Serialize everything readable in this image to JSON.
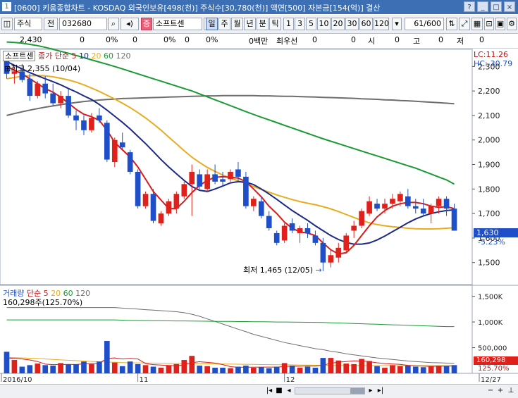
{
  "window": {
    "title": "[0600] 키움종합차트 - KOSDAQ 외국인보유[498(천)] 주식수[30,780(천)] 액면[500] 자본금[154(억)] 결산",
    "controls": [
      "?",
      "_",
      "□",
      "×"
    ]
  },
  "toolbar": {
    "type_select": "주식",
    "mode": "전",
    "code": "032680",
    "badge": "증",
    "name": "소프트센",
    "periods": [
      "일",
      "주",
      "월",
      "년",
      "분",
      "틱"
    ],
    "active_period": "일",
    "intervals": [
      "1",
      "3",
      "5",
      "10",
      "20",
      "30",
      "60",
      "120"
    ],
    "count": "61",
    "count_total": "/600"
  },
  "inforow": {
    "values": [
      "2,430",
      "0",
      "0%",
      "0",
      "0%",
      "0",
      "0%",
      "0백만",
      "최우선",
      "0",
      "0",
      "시",
      "0",
      "고",
      "0",
      "저",
      "0"
    ]
  },
  "price_panel": {
    "legend_name": "소프트센",
    "legend_ma": "종가 단순",
    "ma_periods": [
      "5",
      "10",
      "20",
      "60",
      "120"
    ],
    "high_label": "최고 2,355 (10/04)",
    "low_label": "최저 1,465 (12/05)",
    "lc": "LC:11.26",
    "hc": "HC:-30.79",
    "current_price": "1,630",
    "change_pct": "-5.23%"
  },
  "volume_panel": {
    "legend_name": "거래량",
    "legend_ma": "단순",
    "ma_periods": [
      "5",
      "20",
      "60",
      "120"
    ],
    "legend_value": "160,298주(125.70%)",
    "current_volume": "160,298",
    "current_pct": "125.70%"
  },
  "colors": {
    "up": "#e0211b",
    "down": "#1f4fc8",
    "ma5": "#d61c1c",
    "ma10": "#1c2a86",
    "ma20": "#e8ad1f",
    "ma60": "#199a32",
    "ma120": "#6e6e6e"
  },
  "chart_data": [
    {
      "type": "candlestick",
      "price_axis": {
        "ticks": [
          1500,
          1600,
          1700,
          1800,
          1900,
          2000,
          2100,
          2200,
          2300
        ],
        "ylim": [
          1410,
          2370
        ]
      },
      "x_labels": [
        {
          "label": "2016/10",
          "index": 0
        },
        {
          "label": "11",
          "index": 17
        },
        {
          "label": "12",
          "index": 36
        },
        {
          "label": "12/27",
          "index": 52
        }
      ],
      "candles": [
        {
          "o": 2330,
          "h": 2355,
          "l": 2250,
          "c": 2270
        },
        {
          "o": 2270,
          "h": 2300,
          "l": 2230,
          "c": 2280
        },
        {
          "o": 2280,
          "h": 2310,
          "l": 2235,
          "c": 2245
        },
        {
          "o": 2250,
          "h": 2270,
          "l": 2160,
          "c": 2180
        },
        {
          "o": 2180,
          "h": 2240,
          "l": 2170,
          "c": 2230
        },
        {
          "o": 2230,
          "h": 2260,
          "l": 2170,
          "c": 2190
        },
        {
          "o": 2190,
          "h": 2230,
          "l": 2140,
          "c": 2150
        },
        {
          "o": 2150,
          "h": 2200,
          "l": 2130,
          "c": 2180
        },
        {
          "o": 2180,
          "h": 2210,
          "l": 2090,
          "c": 2100
        },
        {
          "o": 2100,
          "h": 2120,
          "l": 2040,
          "c": 2080
        },
        {
          "o": 2080,
          "h": 2100,
          "l": 2020,
          "c": 2040
        },
        {
          "o": 2040,
          "h": 2110,
          "l": 2030,
          "c": 2090
        },
        {
          "o": 2100,
          "h": 2130,
          "l": 2070,
          "c": 2080
        },
        {
          "o": 2070,
          "h": 2080,
          "l": 1910,
          "c": 1920
        },
        {
          "o": 1910,
          "h": 2010,
          "l": 1890,
          "c": 2000
        },
        {
          "o": 1990,
          "h": 2030,
          "l": 1960,
          "c": 1970
        },
        {
          "o": 1950,
          "h": 1960,
          "l": 1860,
          "c": 1870
        },
        {
          "o": 1870,
          "h": 1880,
          "l": 1720,
          "c": 1730
        },
        {
          "o": 1730,
          "h": 1790,
          "l": 1720,
          "c": 1780
        },
        {
          "o": 1780,
          "h": 1800,
          "l": 1660,
          "c": 1670
        },
        {
          "o": 1660,
          "h": 1710,
          "l": 1650,
          "c": 1700
        },
        {
          "o": 1700,
          "h": 1760,
          "l": 1690,
          "c": 1750
        },
        {
          "o": 1720,
          "h": 1790,
          "l": 1700,
          "c": 1780
        },
        {
          "o": 1770,
          "h": 1830,
          "l": 1760,
          "c": 1820
        },
        {
          "o": 1820,
          "h": 1900,
          "l": 1690,
          "c": 1870
        },
        {
          "o": 1860,
          "h": 1880,
          "l": 1800,
          "c": 1810
        },
        {
          "o": 1800,
          "h": 1880,
          "l": 1790,
          "c": 1860
        },
        {
          "o": 1860,
          "h": 1900,
          "l": 1820,
          "c": 1830
        },
        {
          "o": 1840,
          "h": 1870,
          "l": 1810,
          "c": 1830
        },
        {
          "o": 1840,
          "h": 1880,
          "l": 1830,
          "c": 1870
        },
        {
          "o": 1880,
          "h": 1910,
          "l": 1830,
          "c": 1850
        },
        {
          "o": 1850,
          "h": 1870,
          "l": 1720,
          "c": 1730
        },
        {
          "o": 1730,
          "h": 1770,
          "l": 1710,
          "c": 1760
        },
        {
          "o": 1750,
          "h": 1770,
          "l": 1680,
          "c": 1690
        },
        {
          "o": 1690,
          "h": 1710,
          "l": 1630,
          "c": 1640
        },
        {
          "o": 1620,
          "h": 1630,
          "l": 1570,
          "c": 1580
        },
        {
          "o": 1590,
          "h": 1660,
          "l": 1580,
          "c": 1650
        },
        {
          "o": 1660,
          "h": 1680,
          "l": 1620,
          "c": 1630
        },
        {
          "o": 1620,
          "h": 1650,
          "l": 1580,
          "c": 1640
        },
        {
          "o": 1640,
          "h": 1660,
          "l": 1600,
          "c": 1620
        },
        {
          "o": 1610,
          "h": 1630,
          "l": 1570,
          "c": 1580
        },
        {
          "o": 1580,
          "h": 1600,
          "l": 1465,
          "c": 1500
        },
        {
          "o": 1500,
          "h": 1550,
          "l": 1480,
          "c": 1530
        },
        {
          "o": 1520,
          "h": 1580,
          "l": 1500,
          "c": 1560
        },
        {
          "o": 1550,
          "h": 1620,
          "l": 1540,
          "c": 1610
        },
        {
          "o": 1630,
          "h": 1670,
          "l": 1600,
          "c": 1650
        },
        {
          "o": 1650,
          "h": 1720,
          "l": 1640,
          "c": 1710
        },
        {
          "o": 1700,
          "h": 1770,
          "l": 1690,
          "c": 1750
        },
        {
          "o": 1740,
          "h": 1760,
          "l": 1710,
          "c": 1720
        },
        {
          "o": 1720,
          "h": 1760,
          "l": 1700,
          "c": 1740
        },
        {
          "o": 1740,
          "h": 1780,
          "l": 1720,
          "c": 1760
        },
        {
          "o": 1750,
          "h": 1790,
          "l": 1730,
          "c": 1780
        },
        {
          "o": 1770,
          "h": 1800,
          "l": 1720,
          "c": 1730
        },
        {
          "o": 1730,
          "h": 1760,
          "l": 1700,
          "c": 1720
        },
        {
          "o": 1720,
          "h": 1760,
          "l": 1690,
          "c": 1700
        },
        {
          "o": 1700,
          "h": 1740,
          "l": 1660,
          "c": 1730
        },
        {
          "o": 1730,
          "h": 1770,
          "l": 1700,
          "c": 1760
        },
        {
          "o": 1760,
          "h": 1770,
          "l": 1690,
          "c": 1720
        },
        {
          "o": 1720,
          "h": 1740,
          "l": 1630,
          "c": 1630
        }
      ],
      "ma120": [
        2100,
        2108,
        2115,
        2122,
        2128,
        2134,
        2139,
        2144,
        2149,
        2153,
        2157,
        2160,
        2163,
        2165,
        2167,
        2169,
        2170,
        2171,
        2172,
        2173,
        2174,
        2175,
        2176,
        2177,
        2178,
        2179,
        2180,
        2180,
        2181,
        2181,
        2181,
        2181,
        2181,
        2180,
        2180,
        2179,
        2178,
        2178,
        2177,
        2176,
        2175,
        2174,
        2173,
        2172,
        2171,
        2170,
        2168,
        2167,
        2166,
        2164,
        2163,
        2161,
        2160,
        2158,
        2156,
        2154,
        2152,
        2150,
        2148
      ],
      "ma60": [
        2400,
        2398,
        2395,
        2390,
        2385,
        2378,
        2370,
        2362,
        2354,
        2345,
        2336,
        2327,
        2318,
        2309,
        2300,
        2290,
        2280,
        2270,
        2260,
        2250,
        2240,
        2230,
        2220,
        2210,
        2200,
        2188,
        2176,
        2164,
        2152,
        2140,
        2128,
        2116,
        2104,
        2093,
        2082,
        2071,
        2060,
        2049,
        2038,
        2027,
        2016,
        2005,
        1995,
        1985,
        1975,
        1965,
        1955,
        1945,
        1935,
        1925,
        1915,
        1905,
        1895,
        1885,
        1873,
        1861,
        1849,
        1837,
        1820
      ],
      "ma20": [
        2250,
        2255,
        2260,
        2262,
        2263,
        2262,
        2258,
        2252,
        2245,
        2236,
        2225,
        2212,
        2198,
        2183,
        2167,
        2150,
        2132,
        2112,
        2090,
        2066,
        2040,
        2012,
        1984,
        1956,
        1930,
        1908,
        1888,
        1872,
        1857,
        1845,
        1833,
        1822,
        1810,
        1798,
        1787,
        1776,
        1766,
        1757,
        1749,
        1742,
        1736,
        1728,
        1719,
        1708,
        1696,
        1684,
        1672,
        1662,
        1655,
        1650,
        1646,
        1643,
        1640,
        1638,
        1637,
        1637,
        1638,
        1640,
        1642
      ],
      "ma10": [
        2320,
        2305,
        2290,
        2275,
        2262,
        2250,
        2238,
        2225,
        2210,
        2196,
        2180,
        2165,
        2145,
        2122,
        2097,
        2072,
        2045,
        2015,
        1985,
        1953,
        1920,
        1890,
        1862,
        1835,
        1810,
        1795,
        1790,
        1800,
        1812,
        1825,
        1830,
        1828,
        1818,
        1800,
        1780,
        1758,
        1735,
        1712,
        1692,
        1672,
        1650,
        1630,
        1610,
        1594,
        1582,
        1575,
        1575,
        1580,
        1592,
        1608,
        1626,
        1644,
        1662,
        1678,
        1690,
        1700,
        1707,
        1712,
        1715
      ],
      "ma5": [
        2300,
        2285,
        2270,
        2250,
        2230,
        2210,
        2195,
        2175,
        2150,
        2125,
        2105,
        2095,
        2080,
        2040,
        1990,
        1960,
        1930,
        1890,
        1840,
        1790,
        1755,
        1720,
        1720,
        1750,
        1785,
        1815,
        1835,
        1848,
        1850,
        1848,
        1845,
        1830,
        1800,
        1768,
        1730,
        1700,
        1665,
        1640,
        1625,
        1620,
        1610,
        1580,
        1552,
        1535,
        1540,
        1570,
        1610,
        1650,
        1686,
        1712,
        1730,
        1740,
        1745,
        1745,
        1740,
        1730,
        1725,
        1728,
        1720
      ]
    },
    {
      "type": "bar",
      "volume_axis": {
        "ticks": [
          500000,
          1000000,
          1500000
        ],
        "tick_labels": [
          "500,000",
          "1,000K",
          "1,500K"
        ],
        "ylim": [
          0,
          1700000
        ]
      },
      "volumes": [
        420000,
        260000,
        130000,
        160000,
        190000,
        160000,
        150000,
        200000,
        170000,
        180000,
        230000,
        180000,
        230000,
        630000,
        210000,
        140000,
        230000,
        180000,
        160000,
        130000,
        110000,
        160000,
        180000,
        260000,
        340000,
        150000,
        140000,
        110000,
        110000,
        100000,
        130000,
        150000,
        110000,
        120000,
        100000,
        130000,
        200000,
        150000,
        110000,
        130000,
        110000,
        300000,
        300000,
        250000,
        190000,
        180000,
        280000,
        240000,
        140000,
        110000,
        160000,
        140000,
        150000,
        130000,
        120000,
        140000,
        150000,
        140000,
        160298
      ],
      "ma120": [
        1280000,
        1280000,
        1280000,
        1280000,
        1280000,
        1280000,
        1280000,
        1280000,
        1280000,
        1280000,
        1280000,
        1280000,
        1280000,
        1280000,
        1280000,
        1270000,
        1260000,
        1250000,
        1240000,
        1230000,
        1220000,
        1210000,
        1200000,
        1180000,
        1150000,
        1110000,
        1060000,
        1010000,
        960000,
        910000,
        860000,
        810000,
        760000,
        720000,
        680000,
        640000,
        600000,
        570000,
        540000,
        510000,
        480000,
        460000,
        430000,
        410000,
        380000,
        360000,
        340000,
        320000,
        300000,
        285000,
        270000,
        255000,
        240000,
        230000,
        220000,
        210000,
        205000,
        200000,
        195000
      ],
      "ma60": [
        1040000,
        1040000,
        1040000,
        1040000,
        1040000,
        1040000,
        1040000,
        1040000,
        1040000,
        1040000,
        1040000,
        1040000,
        1040000,
        1040000,
        1040000,
        1035000,
        1030000,
        1030000,
        1028000,
        1025000,
        1025000,
        1022000,
        1020000,
        1020000,
        1018000,
        1016000,
        1014000,
        1012000,
        1010000,
        1010000,
        1008000,
        1008000,
        1005000,
        1005000,
        1002000,
        1000000,
        1000000,
        998000,
        996000,
        994000,
        992000,
        990000,
        985000,
        980000,
        975000,
        970000,
        965000,
        960000,
        955000,
        950000,
        945000,
        940000,
        935000,
        930000,
        925000,
        920000,
        915000,
        910000,
        910000
      ],
      "ma20": [
        310000,
        305000,
        300000,
        295000,
        290000,
        280000,
        270000,
        262000,
        255000,
        248000,
        240000,
        232000,
        225000,
        220000,
        215000,
        210000,
        206000,
        204000,
        202000,
        200000,
        198000,
        196000,
        194000,
        192000,
        190000,
        188000,
        186000,
        184000,
        182000,
        180000,
        178000,
        176000,
        174000,
        172000,
        170000,
        168000,
        166000,
        164000,
        162000,
        160000,
        158000,
        156000,
        155000,
        154000,
        153000,
        152000,
        152000,
        151000,
        151000,
        150000,
        150000,
        150000,
        150000,
        150000,
        150000,
        150000,
        150000,
        150000,
        150000
      ],
      "ma5": [
        300000,
        290000,
        280000,
        260000,
        230000,
        180000,
        170000,
        172000,
        175000,
        172000,
        186000,
        192000,
        198000,
        290000,
        300000,
        280000,
        290000,
        280000,
        190000,
        170000,
        160000,
        152000,
        148000,
        166000,
        210000,
        226000,
        214000,
        200000,
        170000,
        130000,
        118000,
        120000,
        120000,
        122000,
        122000,
        122000,
        132000,
        140000,
        138000,
        144000,
        140000,
        160000,
        194000,
        218000,
        230000,
        244000,
        240000,
        228000,
        206000,
        190000,
        182000,
        174000,
        156000,
        146000,
        140000,
        136000,
        138000,
        140000,
        144000
      ]
    }
  ]
}
